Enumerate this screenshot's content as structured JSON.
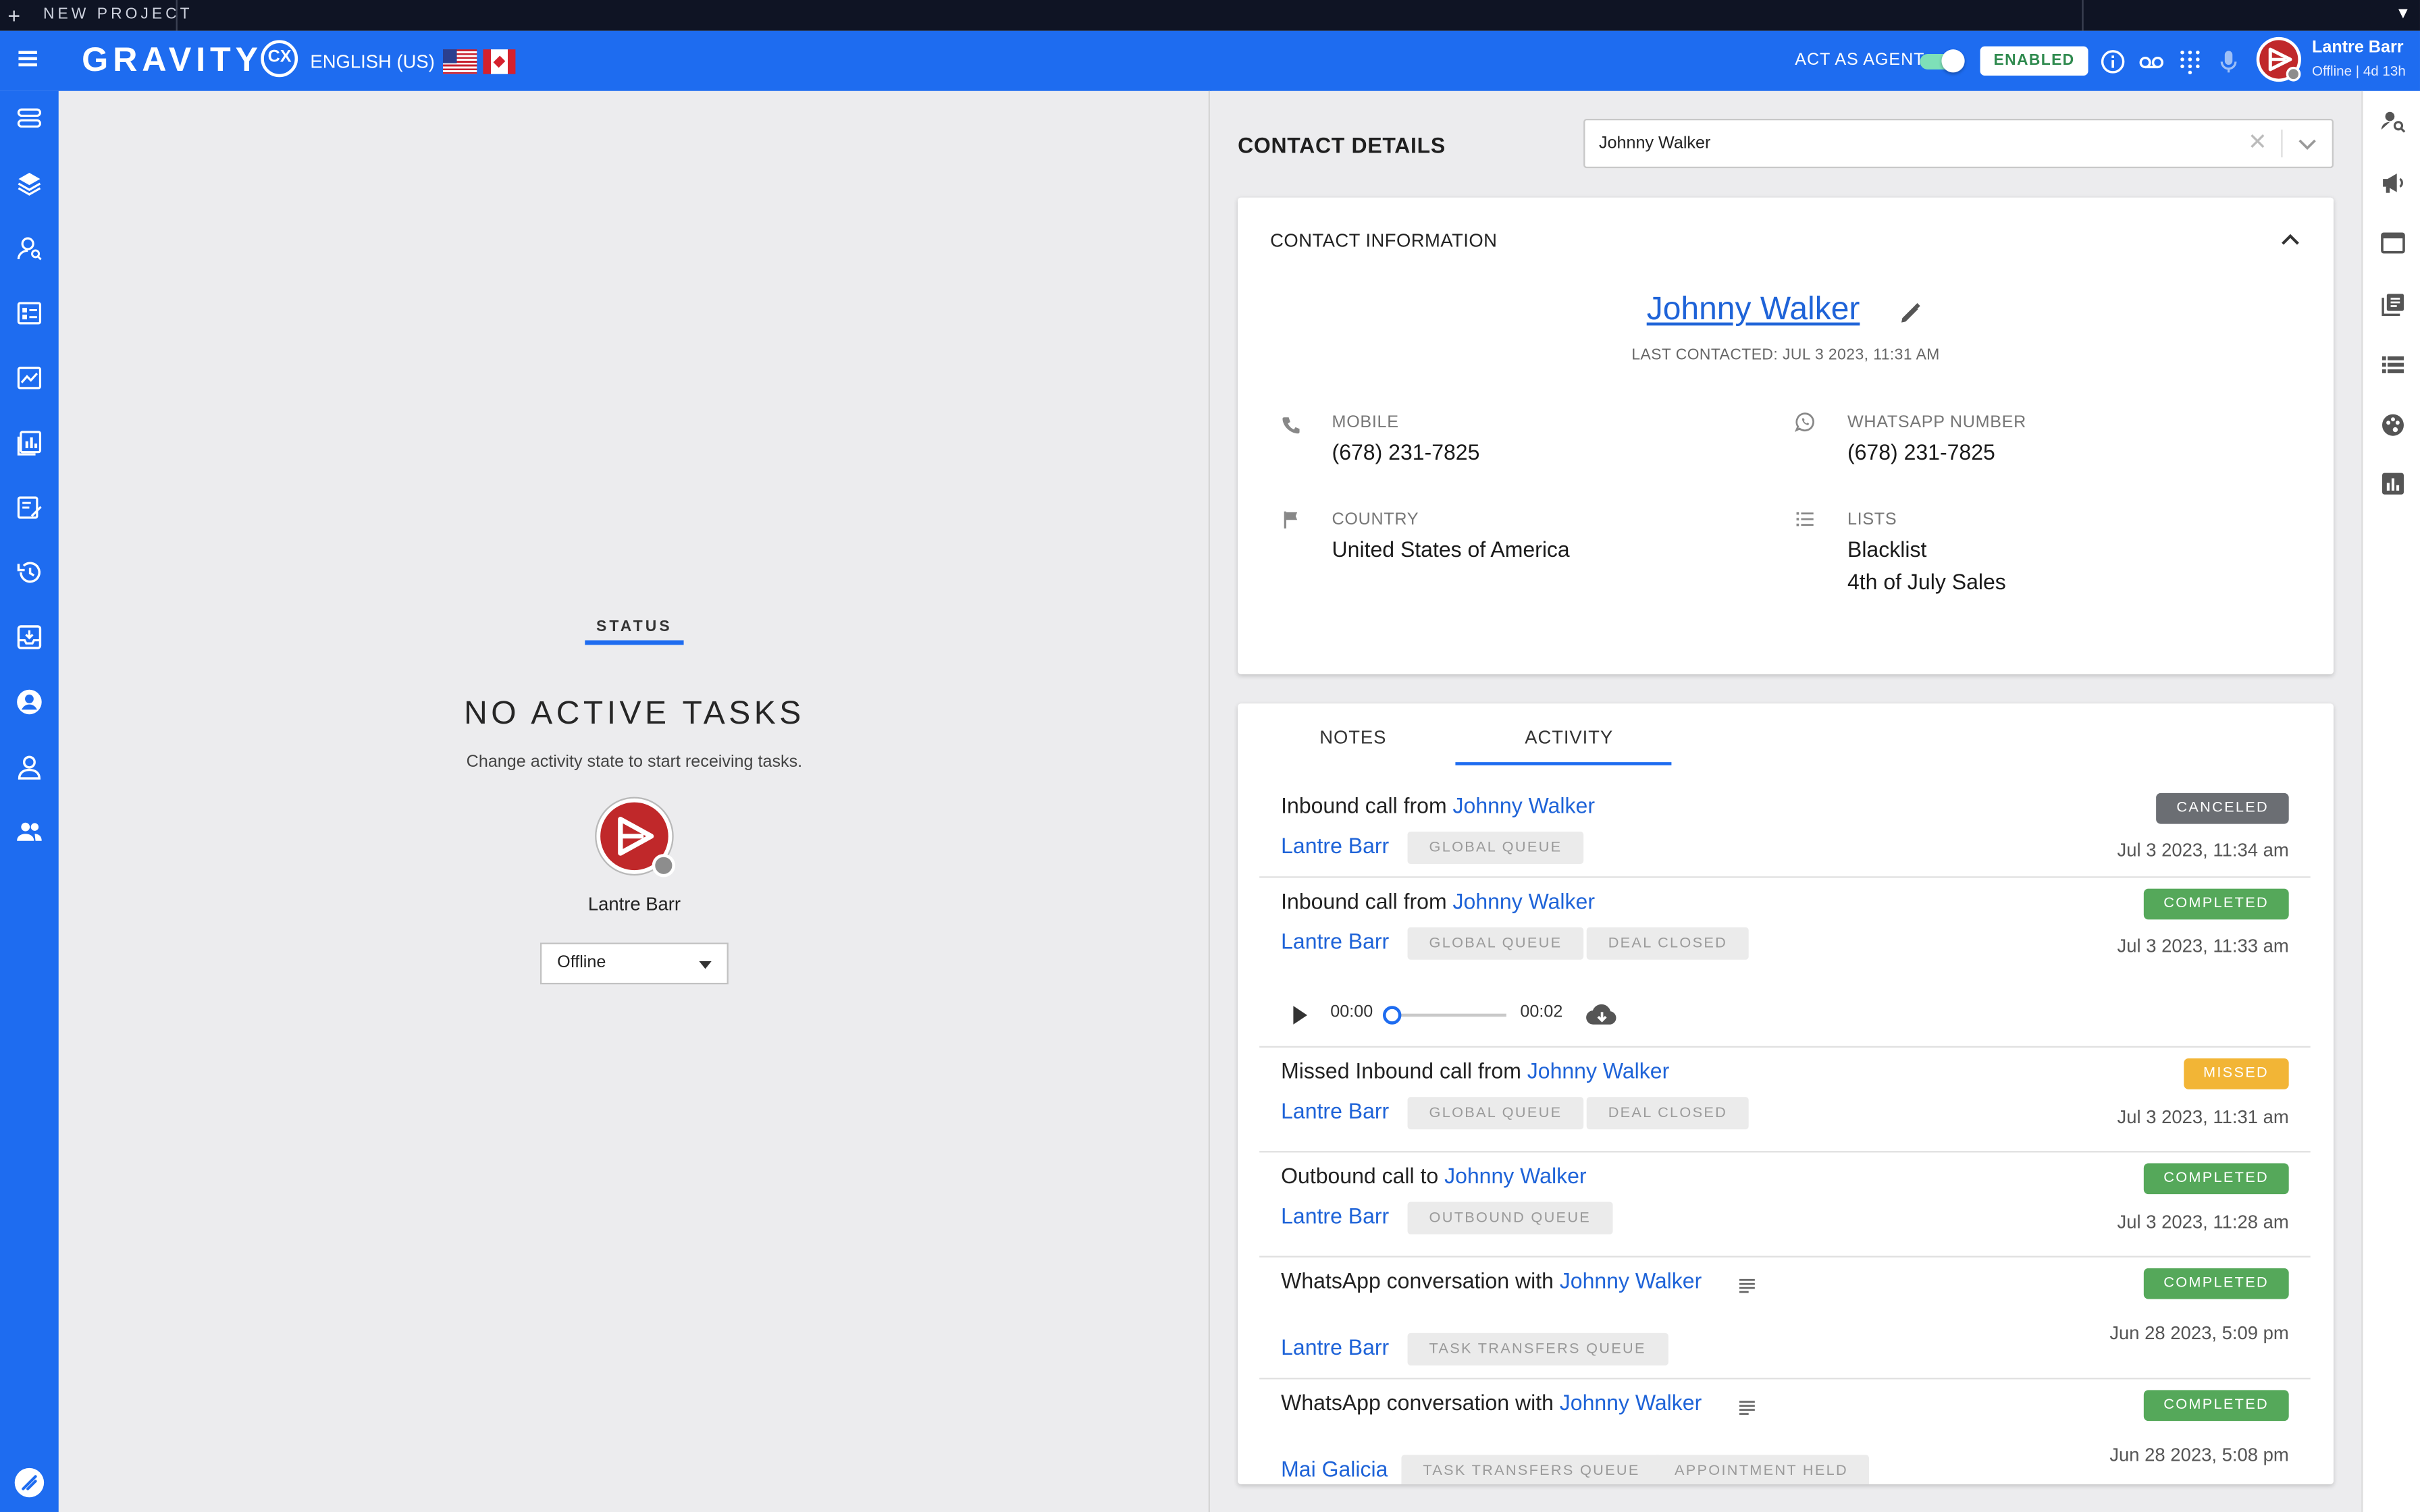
{
  "project_bar": {
    "label": "NEW PROJECT"
  },
  "header": {
    "brand": "GRAVITY",
    "brand_badge": "CX",
    "language": "ENGLISH (US)",
    "act_as_agent": "ACT AS AGENT",
    "act_as_agent_on": true,
    "enabled_label": "ENABLED",
    "user_name": "Lantre Barr",
    "user_status": "Offline | 4d 13h"
  },
  "left_nav": {
    "icons": [
      "queues-icon",
      "layers-icon",
      "contacts-search-icon",
      "campaigns-icon",
      "analytics-icon",
      "reports-icon",
      "forms-icon",
      "history-icon",
      "inbox-icon",
      "account-icon",
      "user-icon",
      "team-icon"
    ],
    "bottom": "quick-link-icon"
  },
  "right_rail": {
    "icons": [
      "contact-search-icon",
      "megaphone-icon",
      "window-icon",
      "library-icon",
      "list-icon",
      "palette-icon",
      "stats-icon"
    ]
  },
  "status_panel": {
    "tab_label": "STATUS",
    "heading": "NO ACTIVE TASKS",
    "subtext": "Change activity state to start receiving tasks.",
    "agent_name": "Lantre Barr",
    "state_value": "Offline"
  },
  "contact_details": {
    "title": "CONTACT DETAILS",
    "search_value": "Johnny Walker"
  },
  "contact_info": {
    "section_title": "CONTACT INFORMATION",
    "name": "Johnny Walker",
    "last_contacted": "LAST CONTACTED: JUL 3 2023, 11:31 AM",
    "mobile_label": "MOBILE",
    "mobile": "(678) 231-7825",
    "whatsapp_label": "WHATSAPP NUMBER",
    "whatsapp": "(678) 231-7825",
    "country_label": "COUNTRY",
    "country": "United States of America",
    "lists_label": "LISTS",
    "lists": [
      "Blacklist",
      "4th of July Sales"
    ]
  },
  "activity_tabs": {
    "notes": "NOTES",
    "activity": "ACTIVITY",
    "selected": "ACTIVITY"
  },
  "activities": [
    {
      "prefix": "Inbound call from ",
      "contact": "Johnny Walker",
      "agent": "Lantre Barr",
      "chips": [
        "GLOBAL QUEUE"
      ],
      "status": "CANCELED",
      "status_color": "#6b6e73",
      "time": "Jul 3 2023, 11:34 am"
    },
    {
      "prefix": "Inbound call from ",
      "contact": "Johnny Walker",
      "agent": "Lantre Barr",
      "chips": [
        "GLOBAL QUEUE",
        "DEAL CLOSED"
      ],
      "status": "COMPLETED",
      "status_color": "#55a85a",
      "time": "Jul 3 2023, 11:33 am",
      "recording": {
        "current": "00:00",
        "total": "00:02",
        "progress": 0
      }
    },
    {
      "prefix": "Missed Inbound call from ",
      "contact": "Johnny Walker",
      "agent": "Lantre Barr",
      "chips": [
        "GLOBAL QUEUE",
        "DEAL CLOSED"
      ],
      "status": "MISSED",
      "status_color": "#f2b536",
      "time": "Jul 3 2023, 11:31 am"
    },
    {
      "prefix": "Outbound call to ",
      "contact": "Johnny Walker",
      "agent": "Lantre Barr",
      "chips": [
        "OUTBOUND QUEUE"
      ],
      "status": "COMPLETED",
      "status_color": "#55a85a",
      "time": "Jul 3 2023, 11:28 am"
    },
    {
      "prefix": "WhatsApp conversation with ",
      "contact": "Johnny Walker",
      "agent": "Lantre Barr",
      "chips": [
        "TASK TRANSFERS QUEUE"
      ],
      "status": "COMPLETED",
      "status_color": "#55a85a",
      "time": "Jun 28 2023, 5:09 pm",
      "has_notes": true
    },
    {
      "prefix": "WhatsApp conversation with ",
      "contact": "Johnny Walker",
      "agent": "Mai Galicia",
      "chips": [
        "TASK TRANSFERS QUEUE",
        "APPOINTMENT HELD"
      ],
      "status": "COMPLETED",
      "status_color": "#55a85a",
      "time": "Jun 28 2023, 5:08 pm",
      "has_notes": true
    }
  ]
}
